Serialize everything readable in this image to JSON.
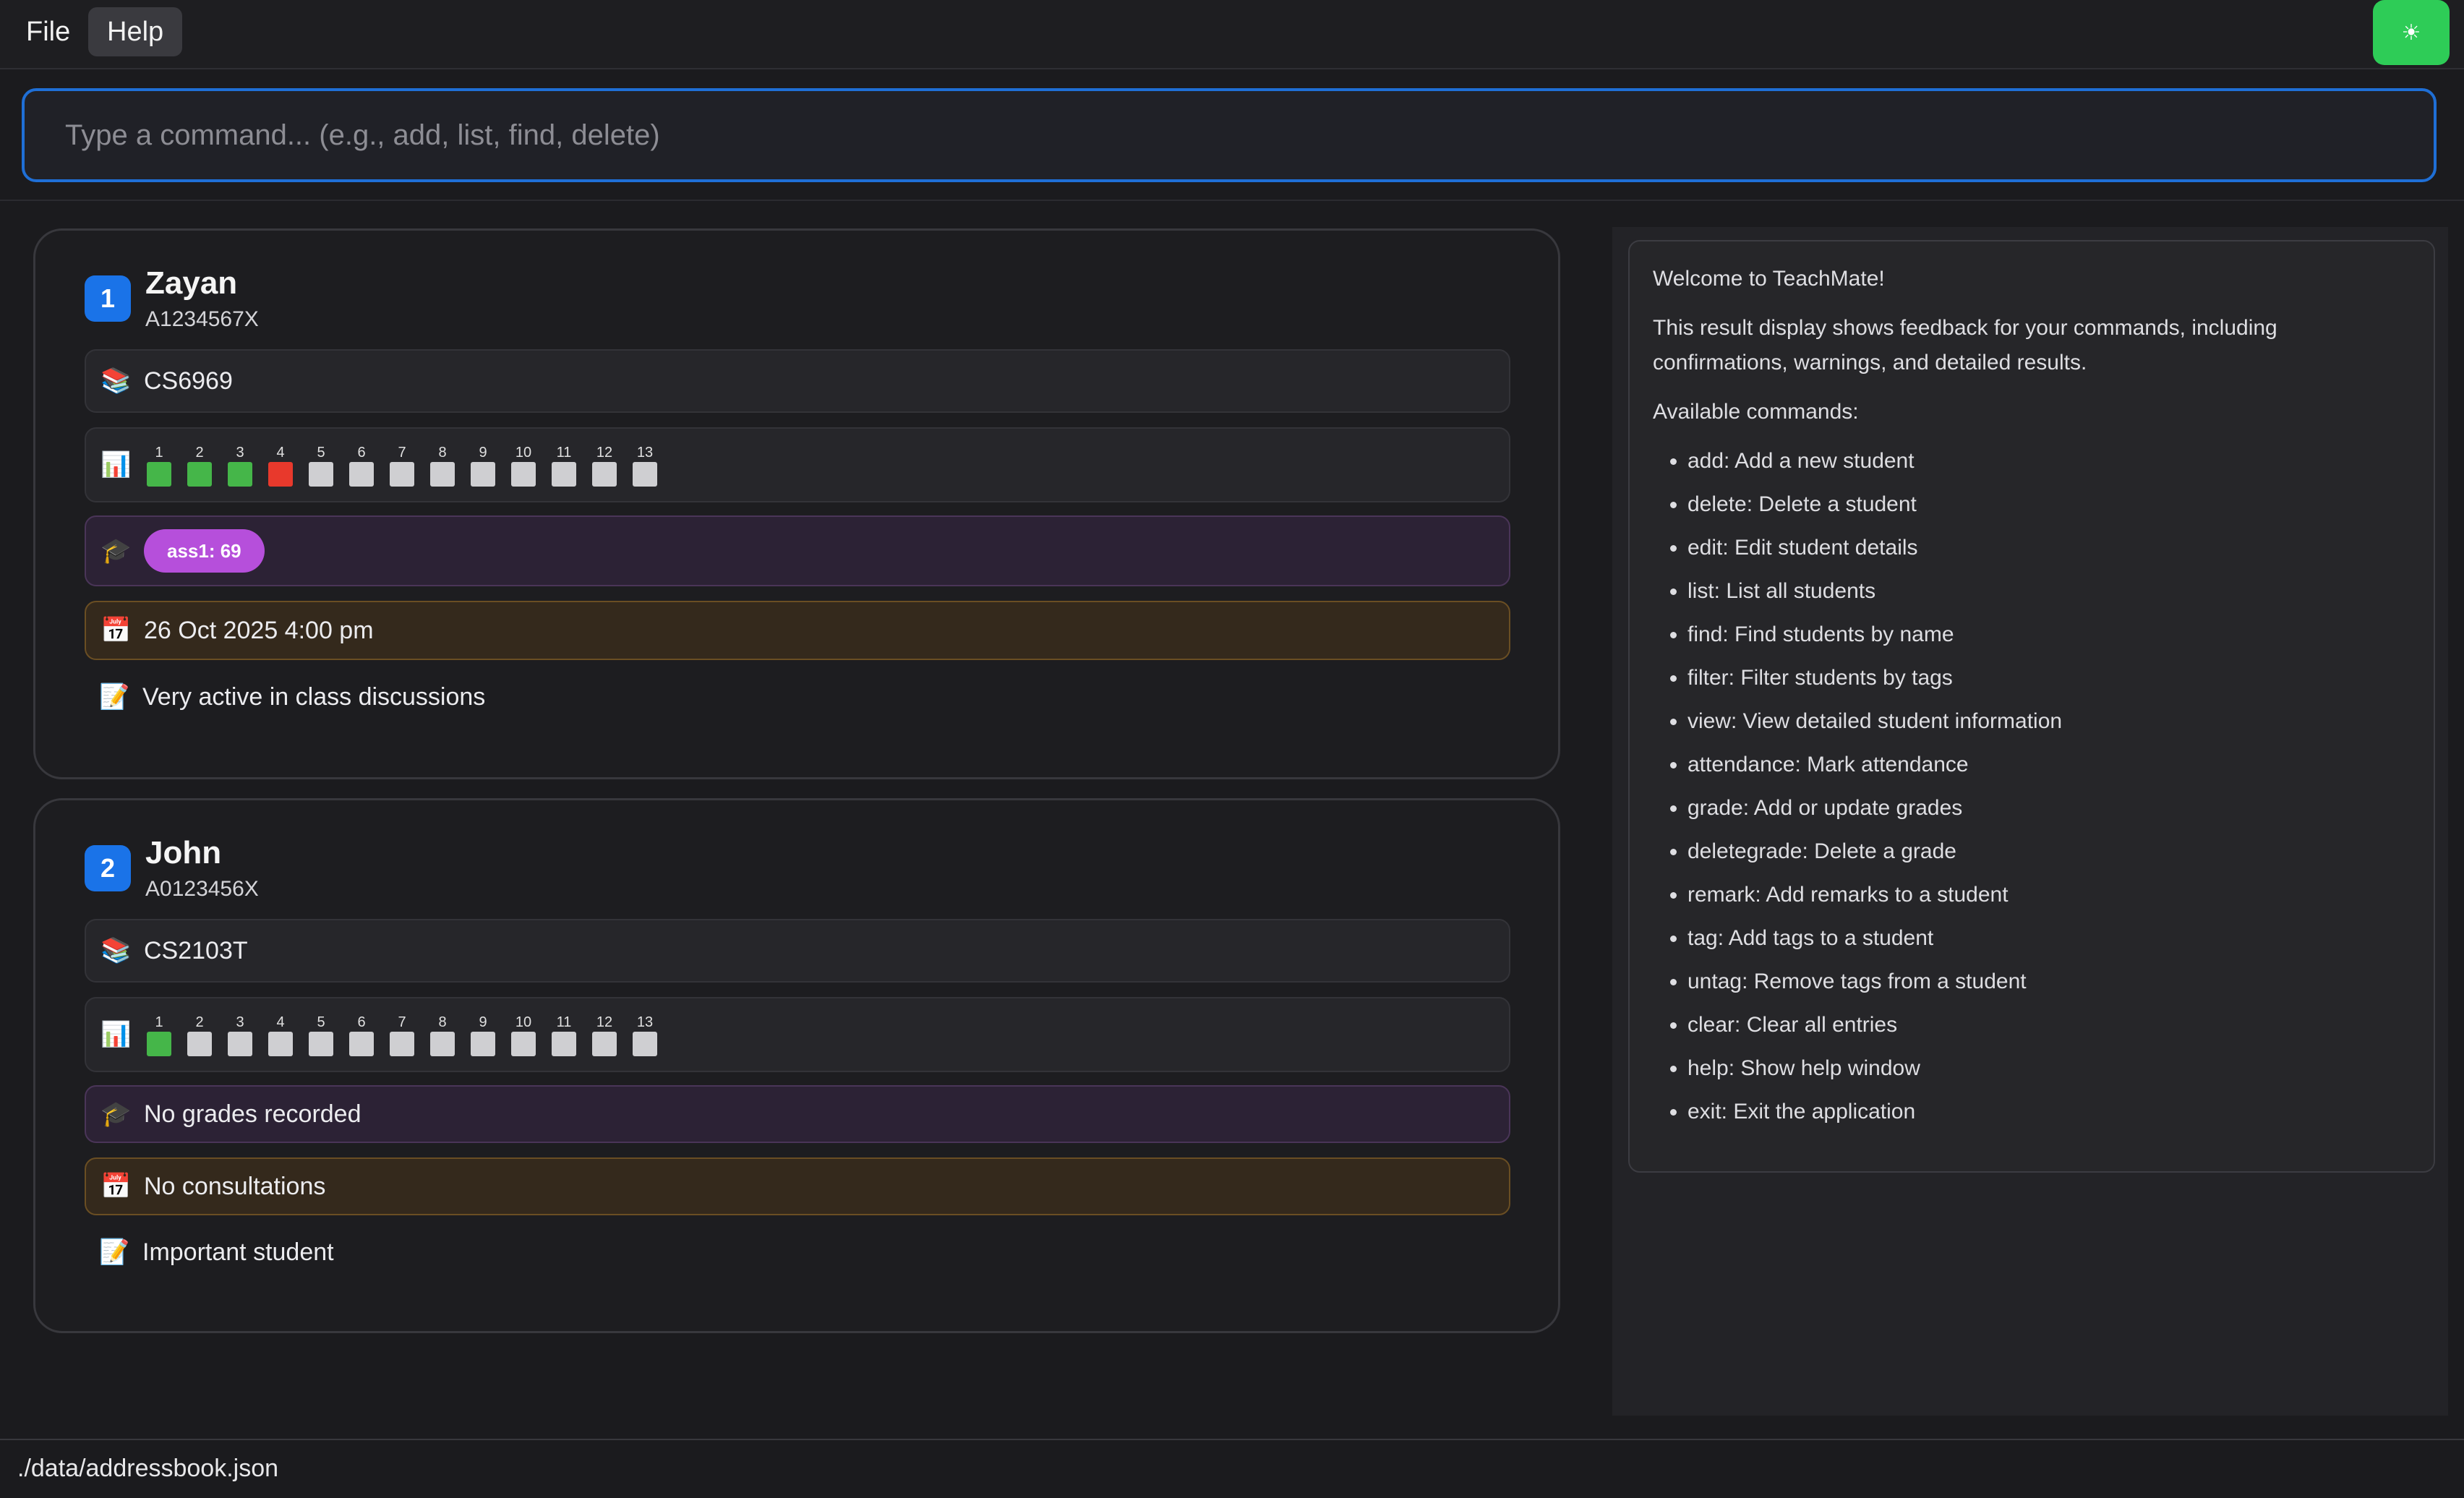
{
  "menu": {
    "file": "File",
    "help": "Help"
  },
  "theme_toggle": {
    "icon": "sun-icon",
    "glyph": "☀",
    "color": "#2ecc57"
  },
  "command": {
    "placeholder": "Type a command... (e.g., add, list, find, delete)",
    "value": ""
  },
  "students": [
    {
      "index": "1",
      "name": "Zayan",
      "id": "A1234567X",
      "module": "CS6969",
      "attendance": {
        "weeks": [
          "1",
          "2",
          "3",
          "4",
          "5",
          "6",
          "7",
          "8",
          "9",
          "10",
          "11",
          "12",
          "13"
        ],
        "status": [
          "present",
          "present",
          "present",
          "absent",
          "none",
          "none",
          "none",
          "none",
          "none",
          "none",
          "none",
          "none",
          "none"
        ]
      },
      "grades": {
        "tags": [
          "ass1: 69"
        ],
        "empty_text": ""
      },
      "consultation": "26 Oct 2025 4:00 pm",
      "remark": "Very active in class discussions"
    },
    {
      "index": "2",
      "name": "John",
      "id": "A0123456X",
      "module": "CS2103T",
      "attendance": {
        "weeks": [
          "1",
          "2",
          "3",
          "4",
          "5",
          "6",
          "7",
          "8",
          "9",
          "10",
          "11",
          "12",
          "13"
        ],
        "status": [
          "present",
          "none",
          "none",
          "none",
          "none",
          "none",
          "none",
          "none",
          "none",
          "none",
          "none",
          "none",
          "none"
        ]
      },
      "grades": {
        "tags": [],
        "empty_text": "No grades recorded"
      },
      "consultation": "No consultations",
      "remark": "Important student"
    }
  ],
  "result": {
    "welcome": "Welcome to TeachMate!",
    "description": "This result display shows feedback for your commands, including confirmations, warnings, and detailed results.",
    "commands_header": "Available commands:",
    "commands": [
      "add: Add a new student",
      "delete: Delete a student",
      "edit: Edit student details",
      "list: List all students",
      "find: Find students by name",
      "filter: Filter students by tags",
      "view: View detailed student information",
      "attendance: Mark attendance",
      "grade: Add or update grades",
      "deletegrade: Delete a grade",
      "remark: Add remarks to a student",
      "tag: Add tags to a student",
      "untag: Remove tags from a student",
      "clear: Clear all entries",
      "help: Show help window",
      "exit: Exit the application"
    ]
  },
  "status_bar": {
    "path": "./data/addressbook.json"
  },
  "colors": {
    "accent": "#1a73e8",
    "present": "#45b649",
    "absent": "#e8392c",
    "unmarked": "#cfcfd2",
    "grade_tag": "#b64fdb"
  }
}
